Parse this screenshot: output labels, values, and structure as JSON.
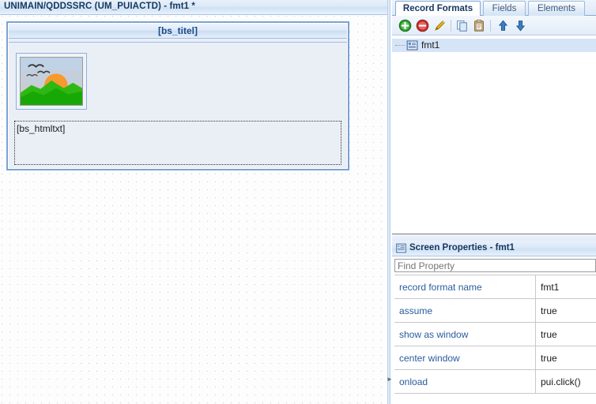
{
  "designer": {
    "title": "UNIMAIN/QDDSSRC (UM_PUIACTD) - fmt1 *",
    "record_format_window": {
      "header_label": "[bs_titel]",
      "image_widget_name": "image-widget",
      "html_text_label": "[bs_htmltxt]"
    }
  },
  "right_panel": {
    "tabs": [
      {
        "label": "Record Formats",
        "active": true
      },
      {
        "label": "Fields",
        "active": false
      },
      {
        "label": "Elements",
        "active": false
      }
    ],
    "toolbar": [
      {
        "name": "add-icon",
        "tooltip": "Add"
      },
      {
        "name": "delete-icon",
        "tooltip": "Delete"
      },
      {
        "name": "edit-pencil-icon",
        "tooltip": "Rename"
      },
      {
        "name": "copy-icon",
        "tooltip": "Copy"
      },
      {
        "name": "paste-icon",
        "tooltip": "Paste"
      },
      {
        "name": "move-up-arrow-icon",
        "tooltip": "Move Up"
      },
      {
        "name": "move-down-arrow-icon",
        "tooltip": "Move Down"
      }
    ],
    "tree": {
      "nodes": [
        {
          "label": "fmt1",
          "icon": "record-format-icon",
          "selected": true
        }
      ]
    },
    "properties": {
      "header_title": "Screen Properties - fmt1",
      "header_icon": "properties-grid-icon",
      "find_placeholder": "Find Property",
      "find_value": "",
      "rows": [
        {
          "name": "record format name",
          "value": "fmt1"
        },
        {
          "name": "assume",
          "value": "true"
        },
        {
          "name": "show as window",
          "value": "true"
        },
        {
          "name": "center window",
          "value": "true"
        },
        {
          "name": "onload",
          "value": "pui.click()"
        }
      ]
    }
  },
  "colors": {
    "title_text": "#15375e",
    "accent_border": "#7ba2d4",
    "property_key": "#2a5c9c",
    "selection": "#d5e4f6"
  }
}
